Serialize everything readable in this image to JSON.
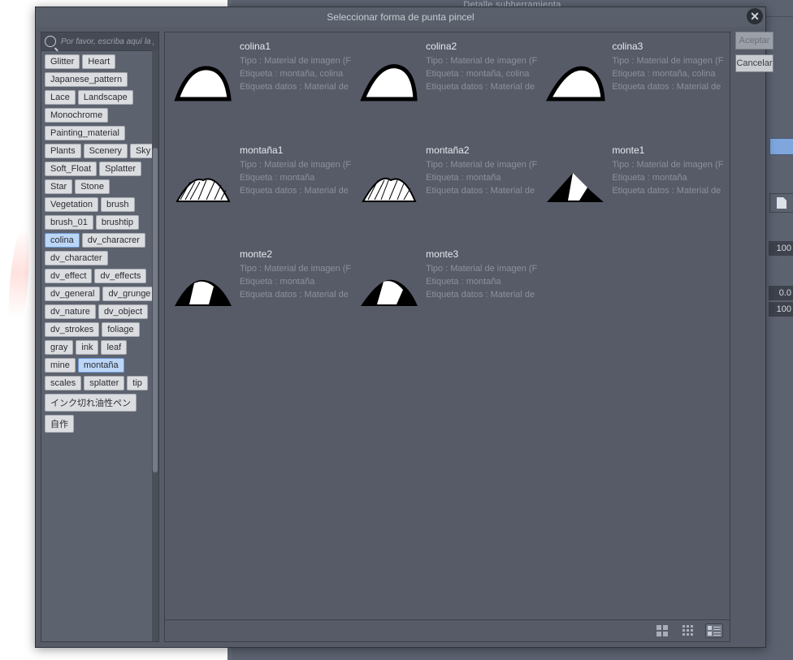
{
  "background_tab_title": "Detalle subherramienta",
  "sidebar_numbers": {
    "a": "100",
    "b": "0.0",
    "c": "100"
  },
  "dialog": {
    "title": "Seleccionar forma de punta pincel",
    "search_placeholder": "Por favor, escriba aquí la palab",
    "ok_label": "Aceptar",
    "cancel_label": "Cancelar",
    "tags": [
      {
        "label": "Glitter"
      },
      {
        "label": "Heart"
      },
      {
        "label": "Japanese_pattern"
      },
      {
        "label": "Lace"
      },
      {
        "label": "Landscape"
      },
      {
        "label": "Monochrome"
      },
      {
        "label": "Painting_material"
      },
      {
        "label": "Plants"
      },
      {
        "label": "Scenery"
      },
      {
        "label": "Sky"
      },
      {
        "label": "Soft_Float"
      },
      {
        "label": "Splatter"
      },
      {
        "label": "Star"
      },
      {
        "label": "Stone"
      },
      {
        "label": "Vegetation"
      },
      {
        "label": "brush"
      },
      {
        "label": "brush_01"
      },
      {
        "label": "brushtip"
      },
      {
        "label": "colina",
        "selected": true
      },
      {
        "label": "dv_characrer"
      },
      {
        "label": "dv_character"
      },
      {
        "label": "dv_effect"
      },
      {
        "label": "dv_effects"
      },
      {
        "label": "dv_general"
      },
      {
        "label": "dv_grunge"
      },
      {
        "label": "dv_nature"
      },
      {
        "label": "dv_object"
      },
      {
        "label": "dv_strokes"
      },
      {
        "label": "foliage"
      },
      {
        "label": "gray"
      },
      {
        "label": "ink"
      },
      {
        "label": "leaf"
      },
      {
        "label": "mine"
      },
      {
        "label": "montaña",
        "selected": true
      },
      {
        "label": "scales"
      },
      {
        "label": "splatter"
      },
      {
        "label": "tip"
      },
      {
        "label": "インク切れ油性ペン"
      },
      {
        "label": "自作"
      }
    ],
    "items": [
      {
        "name": "colina1",
        "type": "Tipo : Material de imagen (F",
        "tag": "Etiqueta : montaña, colina",
        "dtag": "Etiqueta datos : Material de",
        "shape": "hill"
      },
      {
        "name": "colina2",
        "type": "Tipo : Material de imagen (F",
        "tag": "Etiqueta : montaña, colina",
        "dtag": "Etiqueta datos : Material de",
        "shape": "hill2"
      },
      {
        "name": "colina3",
        "type": "Tipo : Material de imagen (F",
        "tag": "Etiqueta : montaña, colina",
        "dtag": "Etiqueta datos : Material de",
        "shape": "hill3"
      },
      {
        "name": "montaña1",
        "type": "Tipo : Material de imagen (F",
        "tag": "Etiqueta : montaña",
        "dtag": "Etiqueta datos : Material de",
        "shape": "hatch1"
      },
      {
        "name": "montaña2",
        "type": "Tipo : Material de imagen (F",
        "tag": "Etiqueta : montaña",
        "dtag": "Etiqueta datos : Material de",
        "shape": "hatch2"
      },
      {
        "name": "monte1",
        "type": "Tipo : Material de imagen (F",
        "tag": "Etiqueta : montaña",
        "dtag": "Etiqueta datos : Material de",
        "shape": "solid1"
      },
      {
        "name": "monte2",
        "type": "Tipo : Material de imagen (F",
        "tag": "Etiqueta : montaña",
        "dtag": "Etiqueta datos : Material de",
        "shape": "solid2"
      },
      {
        "name": "monte3",
        "type": "Tipo : Material de imagen (F",
        "tag": "Etiqueta : montaña",
        "dtag": "Etiqueta datos : Material de",
        "shape": "solid3"
      }
    ]
  }
}
